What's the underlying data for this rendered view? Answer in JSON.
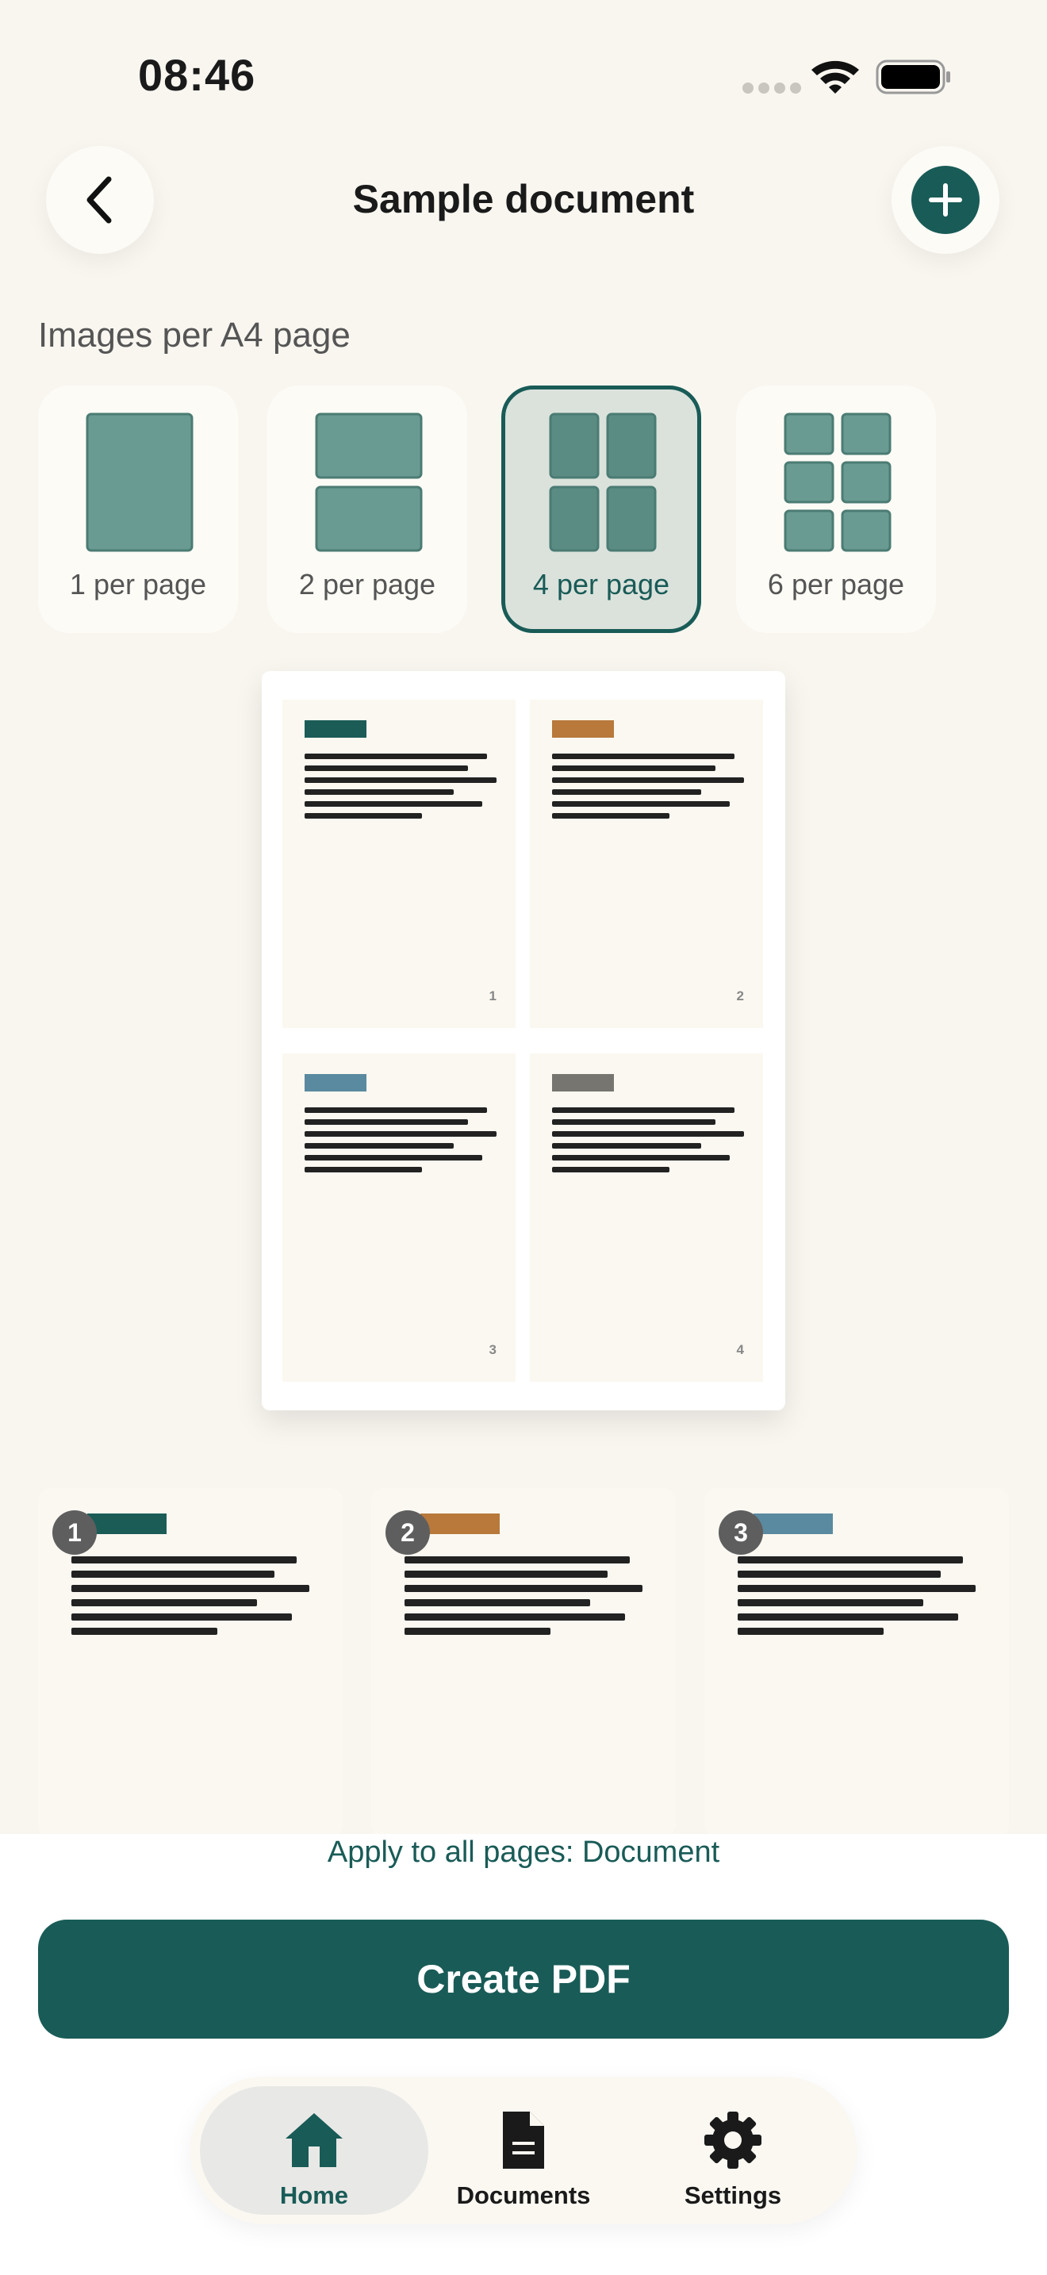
{
  "status_bar": {
    "time": "08:46"
  },
  "header": {
    "title": "Sample document"
  },
  "layout_section": {
    "label": "Images per A4 page",
    "options": [
      {
        "label": "1 per page",
        "selected": false
      },
      {
        "label": "2 per page",
        "selected": false
      },
      {
        "label": "4 per page",
        "selected": true
      },
      {
        "label": "6 per page",
        "selected": false
      }
    ]
  },
  "preview": {
    "pages": [
      {
        "number": "1",
        "tag_color": "#1b5c57"
      },
      {
        "number": "2",
        "tag_color": "#b8793b"
      },
      {
        "number": "3",
        "tag_color": "#5a8aa0"
      },
      {
        "number": "4",
        "tag_color": "#76756f"
      }
    ]
  },
  "thumbnails": [
    {
      "badge": "1",
      "tag_color": "#1b5c57"
    },
    {
      "badge": "2",
      "tag_color": "#b8793b"
    },
    {
      "badge": "3",
      "tag_color": "#5a8aa0"
    }
  ],
  "bottom": {
    "apply_text": "Apply to all pages: Document",
    "create_button": "Create PDF"
  },
  "tab_bar": {
    "tabs": [
      {
        "label": "Home",
        "icon": "home-icon",
        "active": true
      },
      {
        "label": "Documents",
        "icon": "document-icon",
        "active": false
      },
      {
        "label": "Settings",
        "icon": "gear-icon",
        "active": false
      }
    ]
  },
  "colors": {
    "accent": "#195b57",
    "background": "#f9f6f0",
    "tile": "#6a9b93"
  }
}
